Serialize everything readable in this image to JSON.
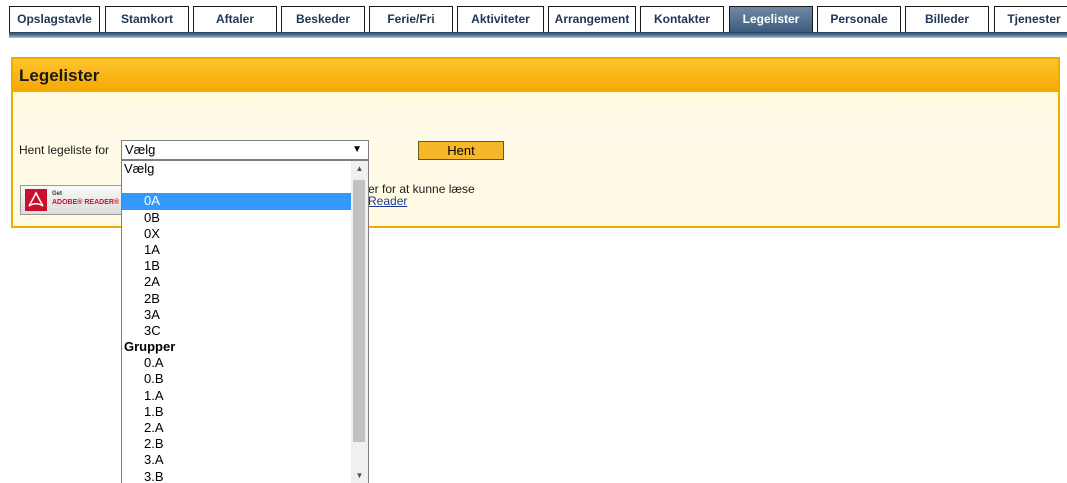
{
  "nav": {
    "tabs": [
      {
        "label": "Opslagstavle"
      },
      {
        "label": "Stamkort"
      },
      {
        "label": "Aftaler"
      },
      {
        "label": "Beskeder"
      },
      {
        "label": "Ferie/Fri"
      },
      {
        "label": "Aktiviteter"
      },
      {
        "label": "Arrangement"
      },
      {
        "label": "Kontakter"
      },
      {
        "label": "Legelister"
      },
      {
        "label": "Personale"
      },
      {
        "label": "Billeder"
      },
      {
        "label": "Tjenester"
      }
    ],
    "active_tab": "Legelister"
  },
  "panel": {
    "title": "Legelister",
    "form_label": "Hent legeliste for",
    "select_value": "Vælg",
    "button_label": "Hent",
    "info_text": "er for at kunne læse",
    "info_link": "Reader"
  },
  "adobe": {
    "get": "Get",
    "reader": "ADOBE® READER®"
  },
  "dropdown": {
    "options": [
      {
        "label": "Vælg",
        "type": "plain"
      },
      {
        "label": "",
        "type": "plain"
      },
      {
        "label": "0A",
        "type": "indent",
        "selected": true
      },
      {
        "label": "0B",
        "type": "indent"
      },
      {
        "label": "0X",
        "type": "indent"
      },
      {
        "label": "1A",
        "type": "indent"
      },
      {
        "label": "1B",
        "type": "indent"
      },
      {
        "label": "2A",
        "type": "indent"
      },
      {
        "label": "2B",
        "type": "indent"
      },
      {
        "label": "3A",
        "type": "indent"
      },
      {
        "label": "3C",
        "type": "indent"
      },
      {
        "label": "Grupper",
        "type": "group"
      },
      {
        "label": "0.A",
        "type": "indent"
      },
      {
        "label": "0.B",
        "type": "indent"
      },
      {
        "label": "1.A",
        "type": "indent"
      },
      {
        "label": "1.B",
        "type": "indent"
      },
      {
        "label": "2.A",
        "type": "indent"
      },
      {
        "label": "2.B",
        "type": "indent"
      },
      {
        "label": "3.A",
        "type": "indent"
      },
      {
        "label": "3.B",
        "type": "indent"
      }
    ]
  },
  "colors": {
    "panel_border": "#f2a900",
    "panel_header": "#f6a800",
    "selected_option": "#3399ff",
    "active_tab": "#3d5c7d"
  }
}
